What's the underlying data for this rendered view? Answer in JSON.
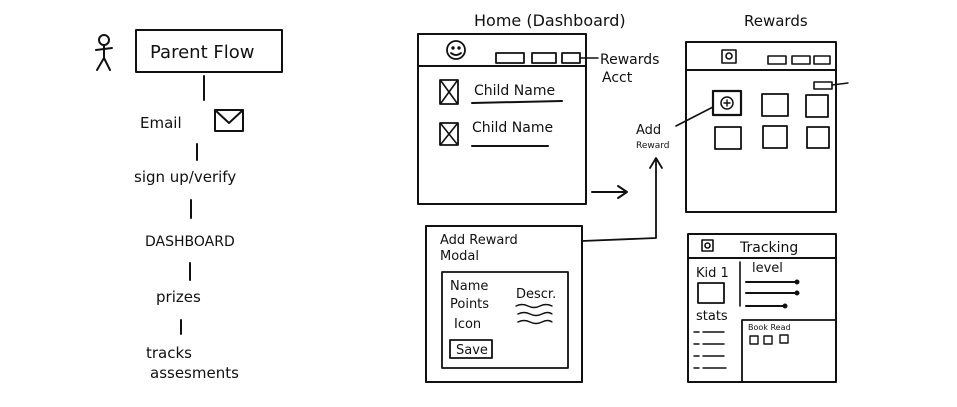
{
  "flow": {
    "title": "Parent Flow",
    "steps": [
      "Email",
      "sign up/verify",
      "DASHBOARD",
      "prizes",
      "tracks",
      "assesments"
    ]
  },
  "home": {
    "title": "Home (Dashboard)",
    "rewards_label": "Rewards",
    "acct_label": "Acct",
    "child_names": [
      "Child Name",
      "Child Name"
    ]
  },
  "add_reward_label": [
    "Add",
    "Reward"
  ],
  "modal": {
    "title_line1": "Add Reward",
    "title_line2": "Modal",
    "fields": [
      "Name",
      "Points",
      "Icon"
    ],
    "desc_label": "Descr.",
    "save_label": "Save"
  },
  "rewards_screen": {
    "title": "Rewards"
  },
  "tracking": {
    "title": "Tracking",
    "kid_label": "Kid 1",
    "level_label": "level",
    "stats_label": "stats",
    "book_read_label": "Book Read"
  }
}
